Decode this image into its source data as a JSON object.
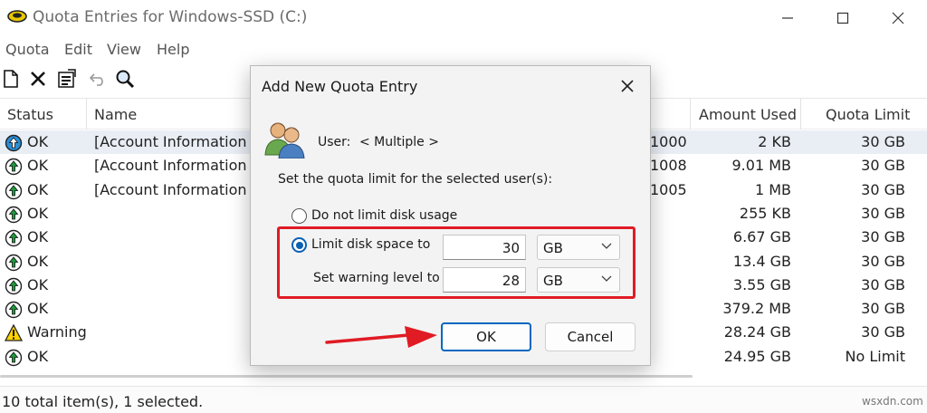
{
  "window": {
    "title": "Quota Entries for Windows-SSD (C:)"
  },
  "menu": {
    "items": [
      "Quota",
      "Edit",
      "View",
      "Help"
    ]
  },
  "toolbar": {
    "icons": [
      "new-entry-icon",
      "delete-icon",
      "properties-icon",
      "undo-icon",
      "find-icon"
    ]
  },
  "list": {
    "columns": {
      "status": "Status",
      "name": "Name",
      "amount_used": "Amount Used",
      "quota_limit": "Quota Limit"
    },
    "rows": [
      {
        "status": "OK",
        "name": "[Account Information U",
        "logon_tail": "1000",
        "used": "2 KB",
        "limit": "30 GB",
        "icon": "ok-icon"
      },
      {
        "status": "OK",
        "name": "[Account Information U",
        "logon_tail": "1008",
        "used": "9.01 MB",
        "limit": "30 GB",
        "icon": "ok-icon"
      },
      {
        "status": "OK",
        "name": "[Account Information U",
        "logon_tail": "1005",
        "used": "1 MB",
        "limit": "30 GB",
        "icon": "ok-icon"
      },
      {
        "status": "OK",
        "name": "",
        "logon_tail": "",
        "used": "255 KB",
        "limit": "30 GB",
        "icon": "ok-icon"
      },
      {
        "status": "OK",
        "name": "",
        "logon_tail": "",
        "used": "6.67 GB",
        "limit": "30 GB",
        "icon": "ok-icon"
      },
      {
        "status": "OK",
        "name": "",
        "logon_tail": "",
        "used": "13.4 GB",
        "limit": "30 GB",
        "icon": "ok-icon"
      },
      {
        "status": "OK",
        "name": "",
        "logon_tail": "",
        "used": "3.55 GB",
        "limit": "30 GB",
        "icon": "ok-icon"
      },
      {
        "status": "OK",
        "name": "",
        "logon_tail": "",
        "used": "379.2 MB",
        "limit": "30 GB",
        "icon": "ok-icon"
      },
      {
        "status": "Warning",
        "name": "",
        "logon_tail": "",
        "used": "28.24 GB",
        "limit": "30 GB",
        "icon": "warning-icon"
      },
      {
        "status": "OK",
        "name": "",
        "logon_tail": "",
        "used": "24.95 GB",
        "limit": "No Limit",
        "icon": "ok-icon"
      }
    ]
  },
  "statusbar": {
    "text": "10 total item(s), 1 selected."
  },
  "dialog": {
    "title": "Add New Quota Entry",
    "user_label": "User:",
    "user_value": "< Multiple >",
    "set_label": "Set the quota limit for the selected user(s):",
    "option_no_limit": "Do not limit disk usage",
    "option_limit": "Limit disk space to",
    "warning_label": "Set warning level to",
    "limit_value": "30",
    "limit_unit": "GB",
    "warning_value": "28",
    "warning_unit": "GB",
    "selected_option": "limit",
    "ok_label": "OK",
    "cancel_label": "Cancel"
  },
  "watermark": "wsxdn.com",
  "colors": {
    "highlight": "#e01b24",
    "accent": "#0067c0",
    "selected_row": "#e9eef5"
  }
}
